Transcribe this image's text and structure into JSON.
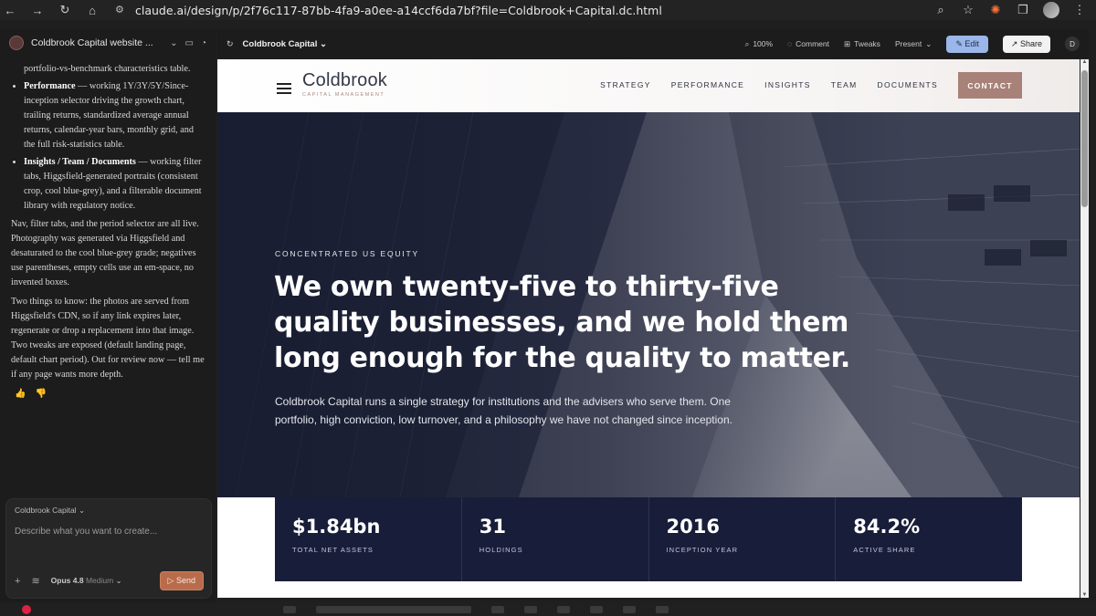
{
  "browser": {
    "url": "claude.ai/design/p/2f76c117-87bb-4fa9-a0ee-a14ccf6da7bf?file=Coldbrook+Capital.dc.html"
  },
  "chat": {
    "project_title": "Coldbrook Capital website ...",
    "continuation": "portfolio-vs-benchmark characteristics table.",
    "bullets": [
      {
        "bold": "Performance",
        "text": " — working 1Y/3Y/5Y/Since-inception selector driving the growth chart, trailing returns, standardized average annual returns, calendar-year bars, monthly grid, and the full risk-statistics table."
      },
      {
        "bold": "Insights / Team / Documents",
        "text": " — working filter tabs, Higgsfield-generated portraits (consistent crop, cool blue-grey), and a filterable document library with regulatory notice."
      }
    ],
    "paragraph_1": "Nav, filter tabs, and the period selector are all live. Photography was generated via Higgsfield and desaturated to the cool blue-grey grade; negatives use parentheses, empty cells use an em-space, no invented boxes.",
    "paragraph_2": "Two things to know: the photos are served from Higgsfield's CDN, so if any link expires later, regenerate or drop a replacement into that image. Two tweaks are exposed (default landing page, default chart period). Out for review now — tell me if any page wants more depth.",
    "composer": {
      "project_label": "Coldbrook Capital",
      "placeholder": "Describe what you want to create...",
      "model": "Opus 4.8",
      "effort": "Medium",
      "send_label": "Send"
    }
  },
  "toolbar": {
    "project_name": "Coldbrook Capital",
    "zoom": "100%",
    "comment": "Comment",
    "tweaks": "Tweaks",
    "present": "Present",
    "edit": "Edit",
    "share": "Share",
    "user_initial": "D"
  },
  "site": {
    "brand_name": "Coldbrook",
    "brand_sub": "CAPITAL MANAGEMENT",
    "nav": [
      "STRATEGY",
      "PERFORMANCE",
      "INSIGHTS",
      "TEAM",
      "DOCUMENTS"
    ],
    "contact": "CONTACT",
    "eyebrow": "CONCENTRATED US EQUITY",
    "headline": "We own twenty-five to thirty-five quality businesses, and we hold them long enough for the quality to matter.",
    "lede": "Coldbrook Capital runs a single strategy for institutions and the advisers who serve them. One portfolio, high conviction, low turnover, and a philosophy we have not changed since inception.",
    "stats": [
      {
        "value": "$1.84bn",
        "label": "TOTAL NET ASSETS"
      },
      {
        "value": "31",
        "label": "HOLDINGS"
      },
      {
        "value": "2016",
        "label": "INCEPTION YEAR"
      },
      {
        "value": "84.2%",
        "label": "ACTIVE SHARE"
      }
    ]
  },
  "colors": {
    "accent_contact": "#a88178",
    "stats_band": "#181d3a",
    "edit_button": "#9bb6e8"
  }
}
